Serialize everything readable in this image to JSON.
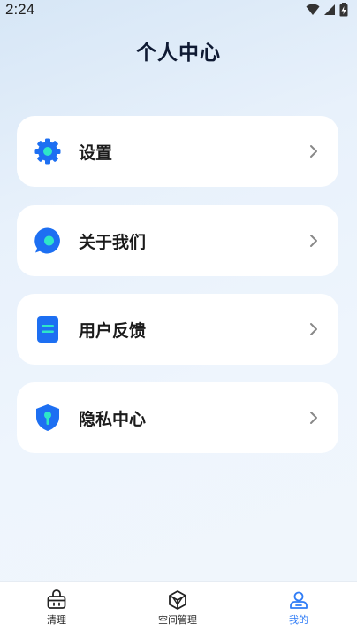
{
  "status": {
    "time": "2:24"
  },
  "page": {
    "title": "个人中心"
  },
  "menu": [
    {
      "label": "设置",
      "icon": "gear-icon"
    },
    {
      "label": "关于我们",
      "icon": "chat-bubble-icon"
    },
    {
      "label": "用户反馈",
      "icon": "document-icon"
    },
    {
      "label": "隐私中心",
      "icon": "shield-icon"
    }
  ],
  "tabs": [
    {
      "label": "清理",
      "icon": "basket-icon",
      "active": false
    },
    {
      "label": "空间管理",
      "icon": "cube-icon",
      "active": false
    },
    {
      "label": "我的",
      "icon": "user-icon",
      "active": true
    }
  ],
  "colors": {
    "accent": "#2f7cf6",
    "icon_blue": "#1d6ff2",
    "icon_teal": "#2ee6c8"
  }
}
